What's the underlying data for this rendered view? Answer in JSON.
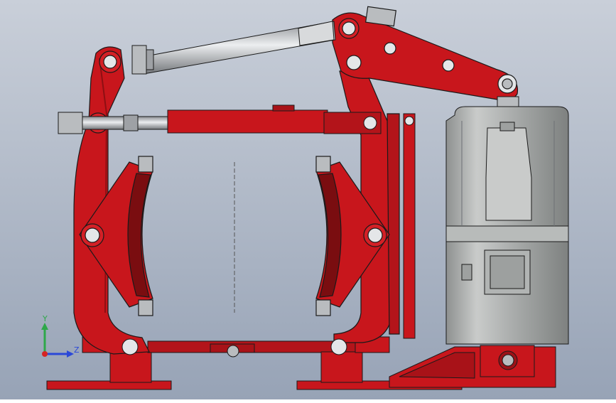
{
  "viewport": {
    "background_top": "#c9cfd9",
    "background_bottom": "#97a3b6"
  },
  "colors": {
    "brake_red": "#c8161c",
    "brake_red_dark": "#8e0f13",
    "brake_red_light": "#e23036",
    "steel": "#b9bcbf",
    "steel_dark": "#6d7075",
    "steel_light": "#e4e6e8",
    "thruster_body": "#a7aaa9",
    "thruster_dark": "#7c7f7f",
    "thruster_light": "#d2d4d3",
    "lining": "#7a0d10",
    "outline": "#1a1a1a"
  },
  "triad": {
    "y_label": "Y",
    "z_label": "Z",
    "y_color": "#2ea84a",
    "z_color": "#2b48d8",
    "x_color": "#d62424"
  },
  "icons": {
    "triad": "coordinate-triad-icon"
  }
}
